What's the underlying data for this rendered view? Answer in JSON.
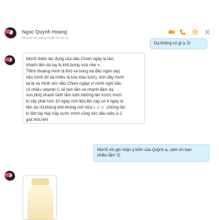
{
  "header": {
    "contact_name": "Ngoc Quynh Hoang",
    "status": "Đã xem bởi Đặng Tuyền lúc 21:07"
  },
  "header_icons": [
    "camera-icon",
    "phone-icon",
    "gear-icon",
    "close-icon"
  ],
  "messages": [
    {
      "side": "out",
      "lines": [
        "Dạ không có gì ạ :D"
      ]
    },
    {
      "side": "in",
      "lines": [
        "MoriS thêm tác dụng của dầu Chùm ngây là làm",
        "nhanh liền da tay bị khô,bong nứa nhe =.",
        "Thỉnh thoảng mình bị khô và bong da đầu ngón tay(",
        "nếu mình lột da nhiều là tứa máu luôn), mới đây mình",
        "lại bị và mình xức dầu Chùm ngây( vì mình nghĩ dầu",
        "có nhiều vitamin C sẽ làm liền và nhanh đám da",
        "non,hihi),nhanh lành lắm luôn.Những lần trước mình",
        "bị vậy phải hơn 10 ngày mới liền,lần này có 4 ngày là",
        "liền da rồi,không khô không nứt nữa☺☺☺ ,những lần",
        "bị đứt tay hay trầy xước mình cũng xức dầu luôn,1-2",
        "giọt thôi,hihi"
      ]
    },
    {
      "side": "out",
      "lines": [
        "MoriS xin ghi nhận ý kiến của Quỳnh ạ, cảm ơn bạn",
        "nhiều lắm :D"
      ]
    }
  ],
  "colors": {
    "outgoing_bubble": "#d7f0fb",
    "incoming_bubble_border": "#dddddd",
    "icon_accent": "#f0a000"
  }
}
